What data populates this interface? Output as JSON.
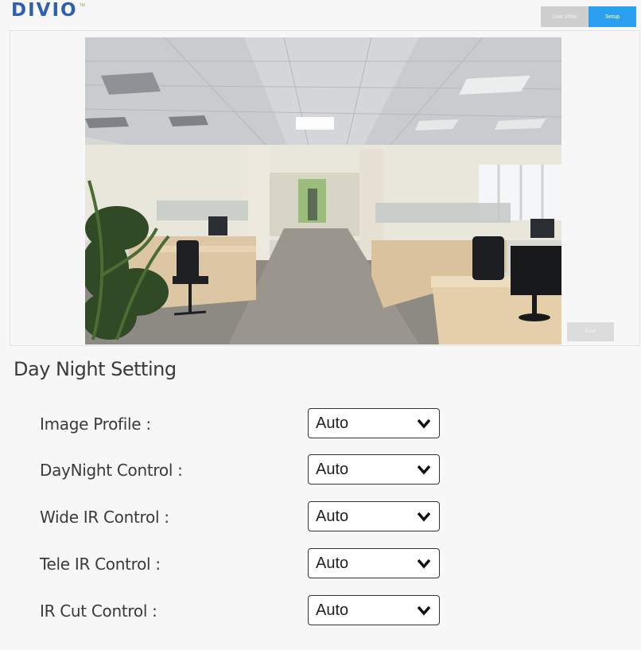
{
  "header": {
    "logo_text": "DIVIO",
    "logo_sub": "TM",
    "tabs": [
      {
        "label": "Live View",
        "active": false
      },
      {
        "label": "Setup",
        "active": true
      }
    ]
  },
  "viewer": {
    "save_label": "Save"
  },
  "section": {
    "title": "Day Night Setting"
  },
  "settings": [
    {
      "label": "Image Profile :",
      "value": "Auto"
    },
    {
      "label": "DayNight Control :",
      "value": "Auto"
    },
    {
      "label": "Wide IR Control :",
      "value": "Auto"
    },
    {
      "label": "Tele IR Control :",
      "value": "Auto"
    },
    {
      "label": "IR Cut Control :",
      "value": "Auto"
    }
  ],
  "colors": {
    "accent": "#2a9ff0",
    "logo": "#2f5fb0",
    "logo_sub": "#7bb93a"
  }
}
